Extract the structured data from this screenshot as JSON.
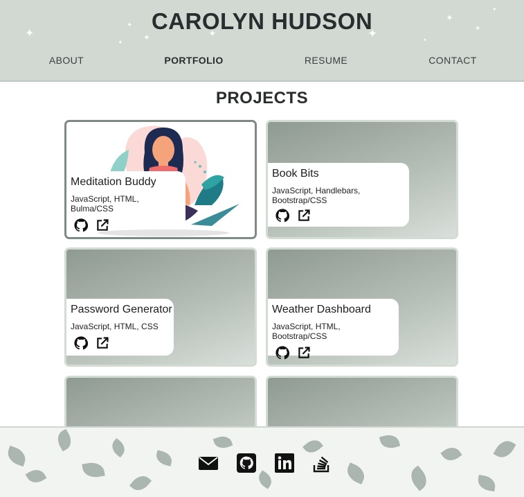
{
  "header": {
    "title": "CAROLYN HUDSON",
    "nav": [
      {
        "label": "ABOUT",
        "active": false
      },
      {
        "label": "PORTFOLIO",
        "active": true
      },
      {
        "label": "RESUME",
        "active": false
      },
      {
        "label": "CONTACT",
        "active": false
      }
    ]
  },
  "projects": {
    "heading": "PROJECTS",
    "items": [
      {
        "title": "Meditation Buddy",
        "tech": "JavaScript, HTML, Bulma/CSS",
        "repo_icon": "github-icon",
        "live_icon": "external-link-icon"
      },
      {
        "title": "Book Bits",
        "tech": "JavaScript, Handlebars, Bootstrap/CSS",
        "repo_icon": "github-icon",
        "live_icon": "external-link-icon"
      },
      {
        "title": "Password Generator",
        "tech": "JavaScript, HTML, CSS",
        "repo_icon": "github-icon",
        "live_icon": "external-link-icon"
      },
      {
        "title": "Weather Dashboard",
        "tech": "JavaScript, HTML, Bootstrap/CSS",
        "repo_icon": "github-icon",
        "live_icon": "external-link-icon"
      }
    ]
  },
  "footer": {
    "icons": [
      "email-icon",
      "github-icon",
      "linkedin-icon",
      "stackoverflow-icon"
    ]
  },
  "colors": {
    "header_bg": "#d2d9d3",
    "card_gradient_dark": "#8f9a93",
    "card_gradient_light": "#d9dfda",
    "text_dark": "#2a2d2e"
  }
}
